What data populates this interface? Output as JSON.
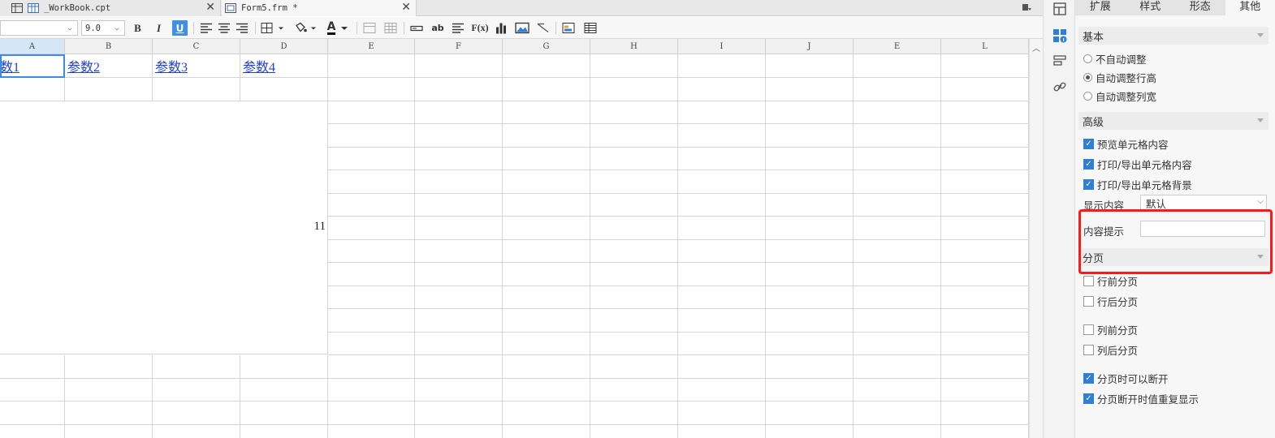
{
  "tabs": [
    {
      "label": "_WorkBook.cpt"
    },
    {
      "label": "Form5.frm *"
    }
  ],
  "toolbar": {
    "font_name": "",
    "font_size": "9.0",
    "bold": "B",
    "italic": "I",
    "underline": "U",
    "font_color_letter": "A",
    "text_ab": "ab",
    "formula": "F(x)"
  },
  "sheet": {
    "columns": [
      "A",
      "B",
      "C",
      "D",
      "E",
      "F",
      "G",
      "H",
      "I",
      "J",
      "E",
      "L"
    ],
    "row1": [
      "数1",
      "参数2",
      "参数3",
      "参数4"
    ],
    "merged_value": "11"
  },
  "panel": {
    "tabs": [
      "扩展",
      "样式",
      "形态",
      "其他"
    ],
    "active_tab": "其他",
    "basic": {
      "title": "基本",
      "options": [
        "不自动调整",
        "自动调整行高",
        "自动调整列宽"
      ],
      "selected": "自动调整行高"
    },
    "advanced": {
      "title": "高级",
      "checks": [
        "预览单元格内容",
        "打印/导出单元格内容",
        "打印/导出单元格背景"
      ],
      "display_label": "显示内容",
      "display_value": "默认",
      "tooltip_label": "内容提示",
      "tooltip_value": ""
    },
    "paging": {
      "title": "分页",
      "row_checks": [
        "行前分页",
        "行后分页"
      ],
      "col_checks": [
        "列前分页",
        "列后分页"
      ],
      "break_checks": [
        "分页时可以断开",
        "分页断开时值重复显示"
      ]
    }
  },
  "colors": {
    "accent": "#2f7fd6",
    "highlight": "#ff1a1a",
    "link": "#1f3fd9"
  }
}
